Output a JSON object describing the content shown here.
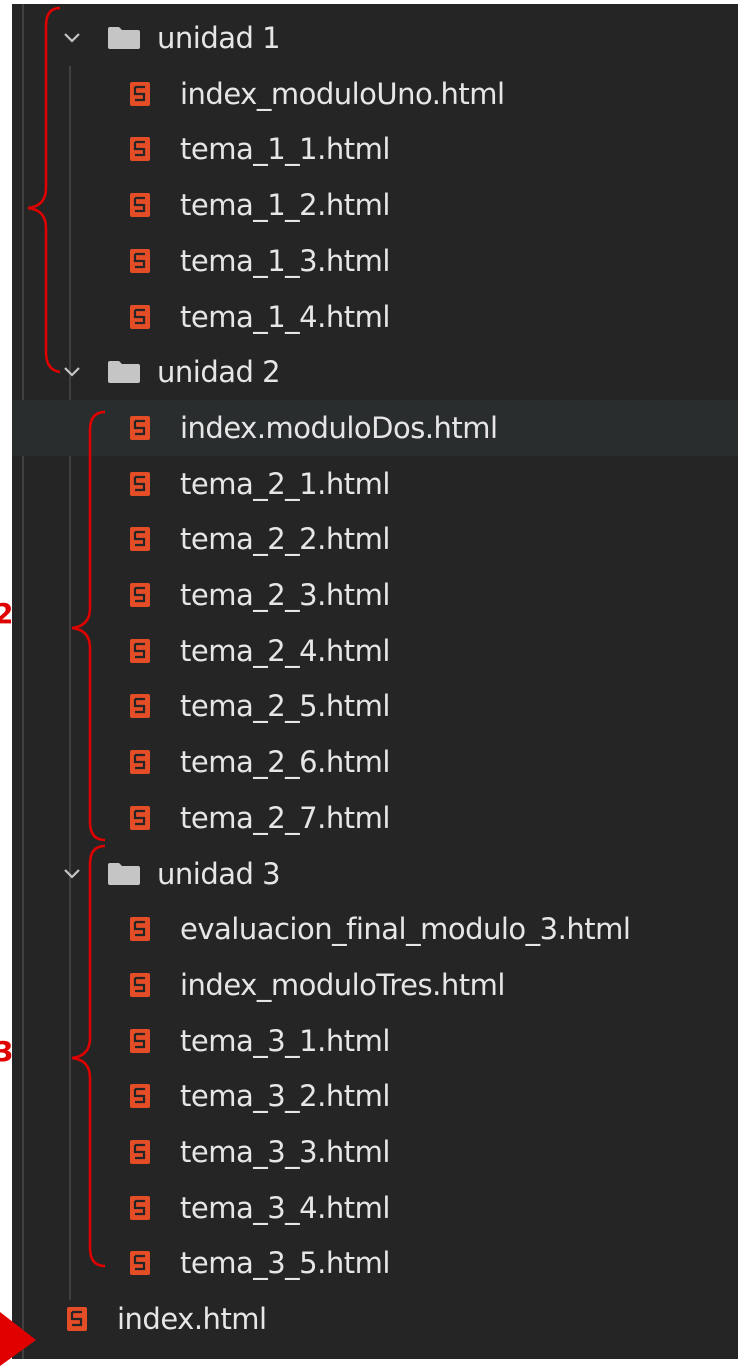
{
  "tree": {
    "folders": [
      {
        "name": "unidad 1",
        "files": [
          "index_moduloUno.html",
          "tema_1_1.html",
          "tema_1_2.html",
          "tema_1_3.html",
          "tema_1_4.html"
        ]
      },
      {
        "name": "unidad 2",
        "files": [
          "index.moduloDos.html",
          "tema_2_1.html",
          "tema_2_2.html",
          "tema_2_3.html",
          "tema_2_4.html",
          "tema_2_5.html",
          "tema_2_6.html",
          "tema_2_7.html"
        ]
      },
      {
        "name": "unidad 3",
        "files": [
          "evaluacion_final_modulo_3.html",
          "index_moduloTres.html",
          "tema_3_1.html",
          "tema_3_2.html",
          "tema_3_3.html",
          "tema_3_4.html",
          "tema_3_5.html"
        ]
      }
    ],
    "root_file": "index.html",
    "selected_file": "index.moduloDos.html"
  },
  "icons": {
    "folder": "folder-icon",
    "file": "html5-icon",
    "expand": "chevron-down-icon"
  },
  "annotations": {
    "labels": [
      "2",
      "3"
    ]
  },
  "colors": {
    "background": "#252526",
    "selected_row": "#2a2d2e",
    "text": "#e6e6e6",
    "html_icon": "#e44d26",
    "folder_icon": "#c5c5c5",
    "annotation": "#e00000",
    "indent_guide": "#404040"
  }
}
